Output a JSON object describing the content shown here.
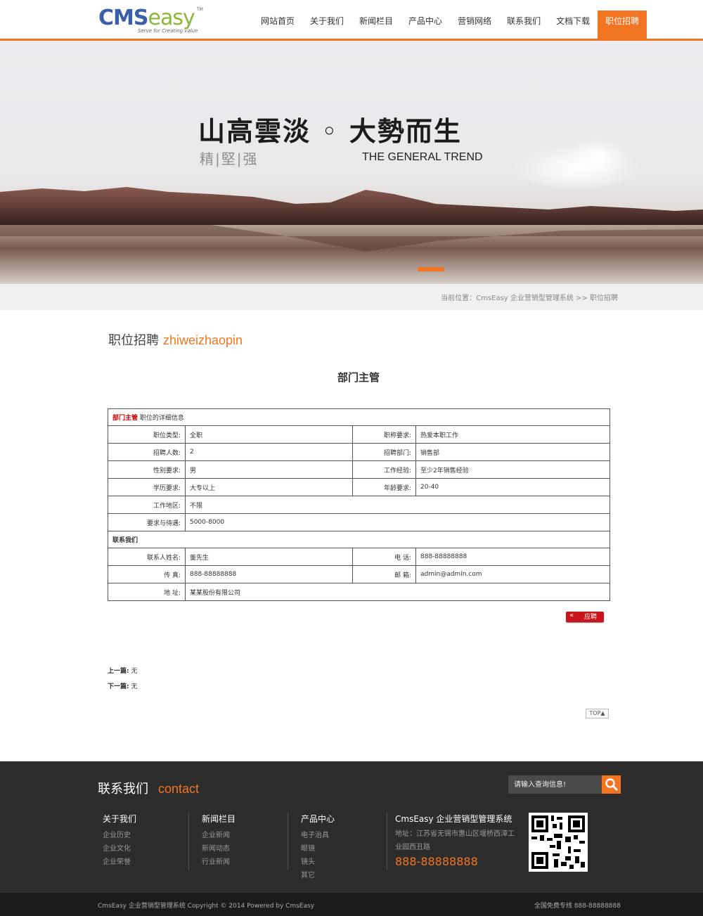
{
  "logo": {
    "brand_a": "CMS",
    "brand_b": "easy",
    "tm": "TM",
    "slogan": "Serve for Creating value"
  },
  "nav": [
    {
      "label": "网站首页"
    },
    {
      "label": "关于我们"
    },
    {
      "label": "新闻栏目"
    },
    {
      "label": "产品中心"
    },
    {
      "label": "营销网络"
    },
    {
      "label": "联系我们"
    },
    {
      "label": "文档下载"
    },
    {
      "label": "职位招聘",
      "active": true
    }
  ],
  "banner": {
    "title_cn": "山高雲淡 ◦ 大勢而生",
    "sub_cn": "精|堅|强",
    "title_en": "THE GENERAL TREND"
  },
  "breadcrumb": "当前位置：CmsEasy 企业营销型管理系统  >> 职位招聘",
  "section": {
    "title_cn": "职位招聘",
    "title_en": "zhiweizhaopin"
  },
  "job": {
    "title": "部门主管",
    "header_red": "部门主管",
    "header_rest": "职位的详细信息",
    "fields": {
      "type_label": "职位类型:",
      "type_value": "全职",
      "title_req_label": "职称要求:",
      "title_req_value": "热爱本职工作",
      "count_label": "招聘人数:",
      "count_value": "2",
      "dept_label": "招聘部门:",
      "dept_value": "销售部",
      "gender_label": "性别要求:",
      "gender_value": "男",
      "exp_label": "工作经验:",
      "exp_value": "至少2年销售经验",
      "edu_label": "学历要求:",
      "edu_value": "大专以上",
      "age_label": "年龄要求:",
      "age_value": "20-40",
      "area_label": "工作地区:",
      "area_value": "不限",
      "salary_label": "要求与待遇:",
      "salary_value": "5000-8000"
    },
    "contact_header": "联系我们",
    "contact": {
      "person_label": "联系人姓名:",
      "person_value": "董先生",
      "phone_label": "电 话:",
      "phone_value": "888-88888888",
      "fax_label": "传 真:",
      "fax_value": "888-88888888",
      "email_label": "邮 箱:",
      "email_value": "admin@admin.com",
      "addr_label": "地 址:",
      "addr_value": "某某股份有限公司"
    },
    "apply_arrow": "«",
    "apply_label": "应聘"
  },
  "prevnext": {
    "prev_label": "上一篇:",
    "prev_value": "无",
    "next_label": "下一篇:",
    "next_value": "无"
  },
  "top_button": "TOP▲",
  "footer": {
    "title_cn": "联系我们",
    "title_en": "contact",
    "search_placeholder": "请输入查询信息!",
    "columns": [
      {
        "head": "关于我们",
        "links": [
          "企业历史",
          "企业文化",
          "企业荣誉"
        ]
      },
      {
        "head": "新闻栏目",
        "links": [
          "企业新闻",
          "新闻动态",
          "行业新闻"
        ]
      },
      {
        "head": "产品中心",
        "links": [
          "电子治具",
          "眼镜",
          "镜头",
          "其它"
        ]
      }
    ],
    "company": "CmsEasy 企业营销型管理系统",
    "address": "地址：江苏省无锡市惠山区堰桥西漳工业园西丑路",
    "phone": "888-88888888",
    "copyright": "CmsEasy 企业营销型管理系统 Copyright © 2014 Powered by CmsEasy",
    "hotline": "全国免费专线 888-88888888"
  },
  "colors": {
    "accent": "#f27621",
    "header_red": "#cc0000",
    "apply_red": "#c9161d",
    "footer_bg": "#2c2c2c"
  }
}
